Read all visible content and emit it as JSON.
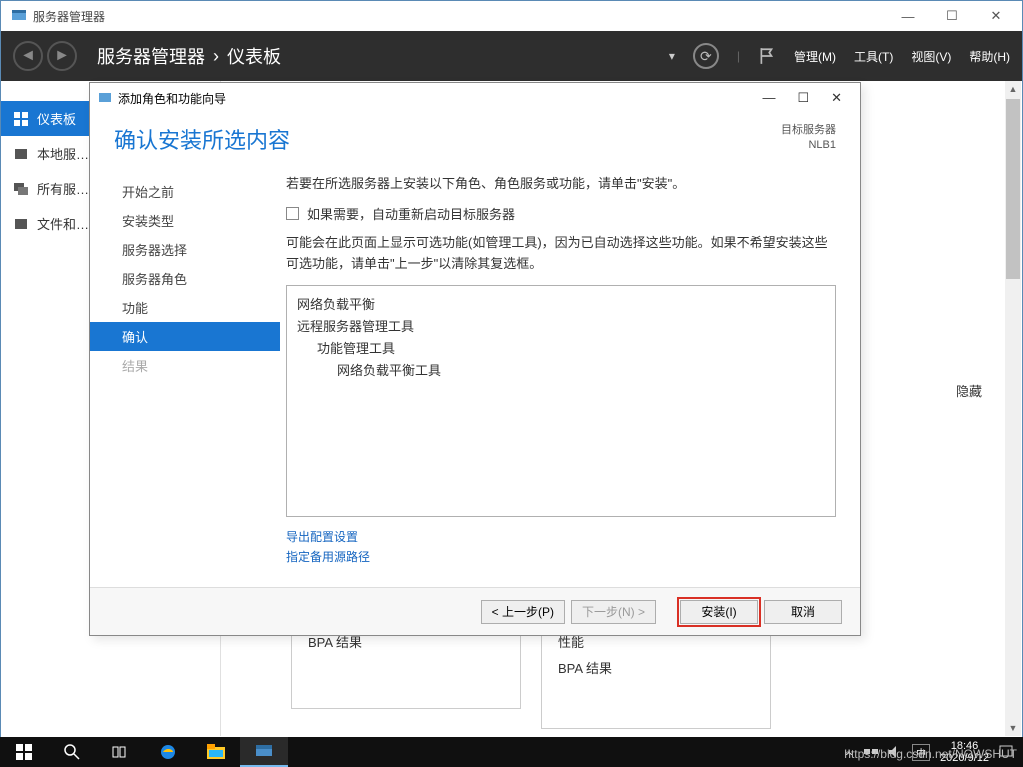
{
  "app": {
    "title": "服务器管理器",
    "breadcrumb": {
      "root": "服务器管理器",
      "current": "仪表板"
    },
    "menu": {
      "manage": "管理(M)",
      "tools": "工具(T)",
      "view": "视图(V)",
      "help": "帮助(H)"
    }
  },
  "sidebar": {
    "items": [
      {
        "label": "仪表板",
        "active": true
      },
      {
        "label": "本地服…"
      },
      {
        "label": "所有服…"
      },
      {
        "label": "文件和…"
      }
    ]
  },
  "tiles": {
    "bpa_result": "BPA 结果",
    "perf": "性能"
  },
  "hidden_label": "隐藏",
  "wizard": {
    "title": "添加角色和功能向导",
    "heading": "确认安装所选内容",
    "target_label": "目标服务器",
    "target_server": "NLB1",
    "steps": {
      "before": "开始之前",
      "type": "安装类型",
      "server_sel": "服务器选择",
      "server_role": "服务器角色",
      "feature": "功能",
      "confirm": "确认",
      "result": "结果"
    },
    "intro": "若要在所选服务器上安装以下角色、角色服务或功能，请单击\"安装\"。",
    "checkbox_label": "如果需要，自动重新启动目标服务器",
    "note": "可能会在此页面上显示可选功能(如管理工具)，因为已自动选择这些功能。如果不希望安装这些可选功能，请单击\"上一步\"以清除其复选框。",
    "features": {
      "f1": "网络负载平衡",
      "f2": "远程服务器管理工具",
      "f3": "功能管理工具",
      "f4": "网络负载平衡工具"
    },
    "links": {
      "export": "导出配置设置",
      "alt_source": "指定备用源路径"
    },
    "buttons": {
      "prev": "< 上一步(P)",
      "next": "下一步(N) >",
      "install": "安装(I)",
      "cancel": "取消"
    }
  },
  "taskbar": {
    "time": "18:46",
    "date": "2020/9/12"
  },
  "watermark": "https://blog.csdn.net/NOWSHUT"
}
